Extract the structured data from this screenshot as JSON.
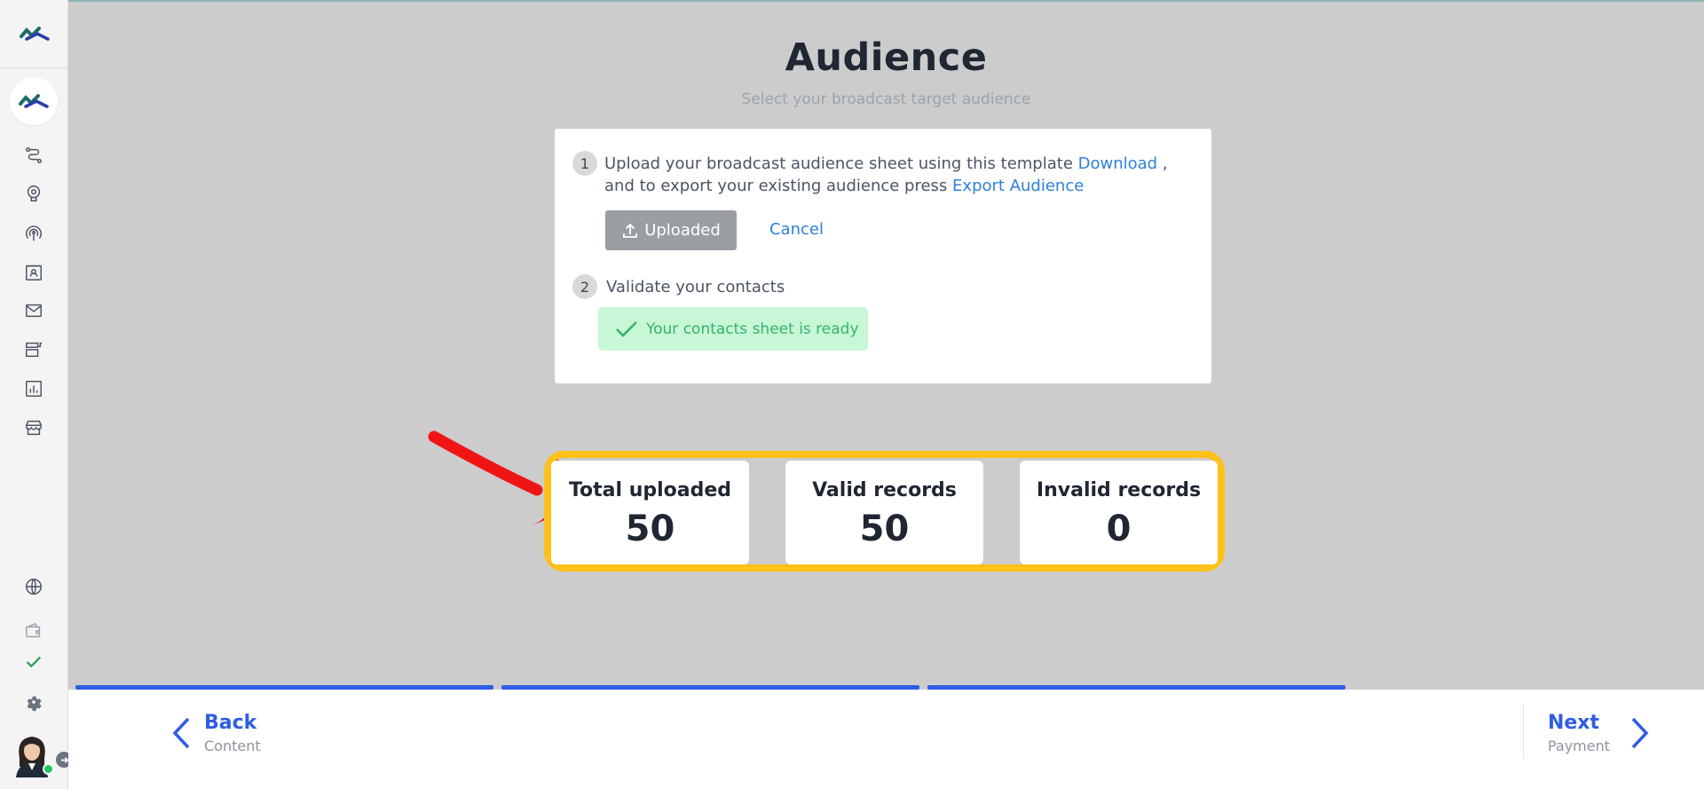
{
  "header": {
    "title": "Audience",
    "subtitle": "Select your broadcast target audience"
  },
  "steps": [
    {
      "number": "1",
      "line1_text": "Upload your broadcast audience sheet using this template",
      "download_link": "Download",
      "comma": ",",
      "line2_text": "and to export your existing audience press",
      "export_link": "Export Audience",
      "upload_button": "Uploaded",
      "cancel_button": "Cancel"
    },
    {
      "number": "2",
      "text": "Validate your contacts",
      "status_message": "Your contacts sheet is ready"
    }
  ],
  "stats": [
    {
      "label": "Total uploaded",
      "value": "50"
    },
    {
      "label": "Valid records",
      "value": "50"
    },
    {
      "label": "Invalid records",
      "value": "0"
    }
  ],
  "progress": {
    "completed_steps": 3,
    "total_steps": 4
  },
  "footer": {
    "back": {
      "label": "Back",
      "sub": "Content"
    },
    "next": {
      "label": "Next",
      "sub": "Payment"
    }
  },
  "sidebar": {
    "items": [
      "routes-icon",
      "bot-icon",
      "broadcast-icon",
      "contacts-icon",
      "mail-icon",
      "integrations-icon",
      "reports-icon",
      "store-icon",
      "globe-icon",
      "wallet-icon",
      "check-icon",
      "settings-icon"
    ]
  },
  "colors": {
    "accent": "#2f5de3",
    "link": "#2f80d8",
    "highlight": "#ffc019",
    "success_bg": "#c7f7d7",
    "success_text": "#37b26a",
    "annotation_arrow": "#f01515"
  }
}
